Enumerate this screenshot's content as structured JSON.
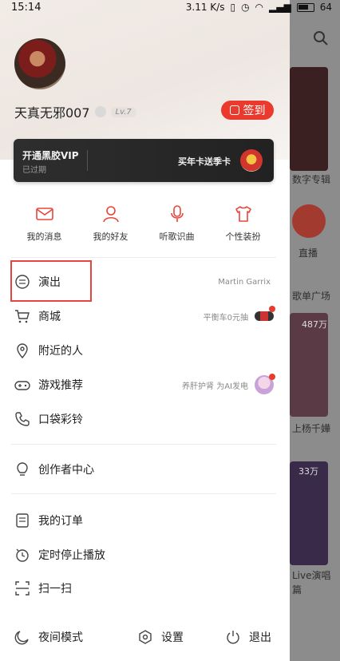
{
  "status": {
    "time": "15:14",
    "speed": "3.11 K/s",
    "battery": "64"
  },
  "profile": {
    "username": "天真无邪007",
    "level": "Lv.7",
    "signin_label": "签到"
  },
  "vip": {
    "title": "开通黑胶VIP",
    "subtitle": "已过期",
    "promo": "买年卡送季卡"
  },
  "quick_actions": [
    {
      "label": "我的消息",
      "icon": "mail-icon"
    },
    {
      "label": "我的好友",
      "icon": "person-icon"
    },
    {
      "label": "听歌识曲",
      "icon": "microphone-icon"
    },
    {
      "label": "个性装扮",
      "icon": "tshirt-icon"
    }
  ],
  "menu": [
    {
      "label": "演出",
      "extra": "Martin Garrix",
      "icon": "ticket-icon"
    },
    {
      "label": "商城",
      "extra": "平衡车0元抽",
      "icon": "cart-icon"
    },
    {
      "label": "附近的人",
      "extra": "",
      "icon": "location-icon"
    },
    {
      "label": "游戏推荐",
      "extra": "养肝护肾 为AI发电",
      "icon": "gamepad-icon"
    },
    {
      "label": "口袋彩铃",
      "extra": "",
      "icon": "ringtone-icon"
    },
    {
      "label": "创作者中心",
      "extra": "",
      "icon": "bulb-icon"
    },
    {
      "label": "我的订单",
      "extra": "",
      "icon": "order-icon"
    },
    {
      "label": "定时停止播放",
      "extra": "",
      "icon": "timer-icon"
    },
    {
      "label": "扫一扫",
      "extra": "",
      "icon": "scan-icon"
    }
  ],
  "bottom": {
    "night": "夜间模式",
    "settings": "设置",
    "quit": "退出"
  },
  "background": {
    "digital_album": "数字专辑",
    "live": "直播",
    "playlist_square": "歌单广场",
    "count1": "487万",
    "singer": "上杨千嬅",
    "count2": "33万",
    "live_concert": "Live演唱",
    "misc": "篇"
  }
}
